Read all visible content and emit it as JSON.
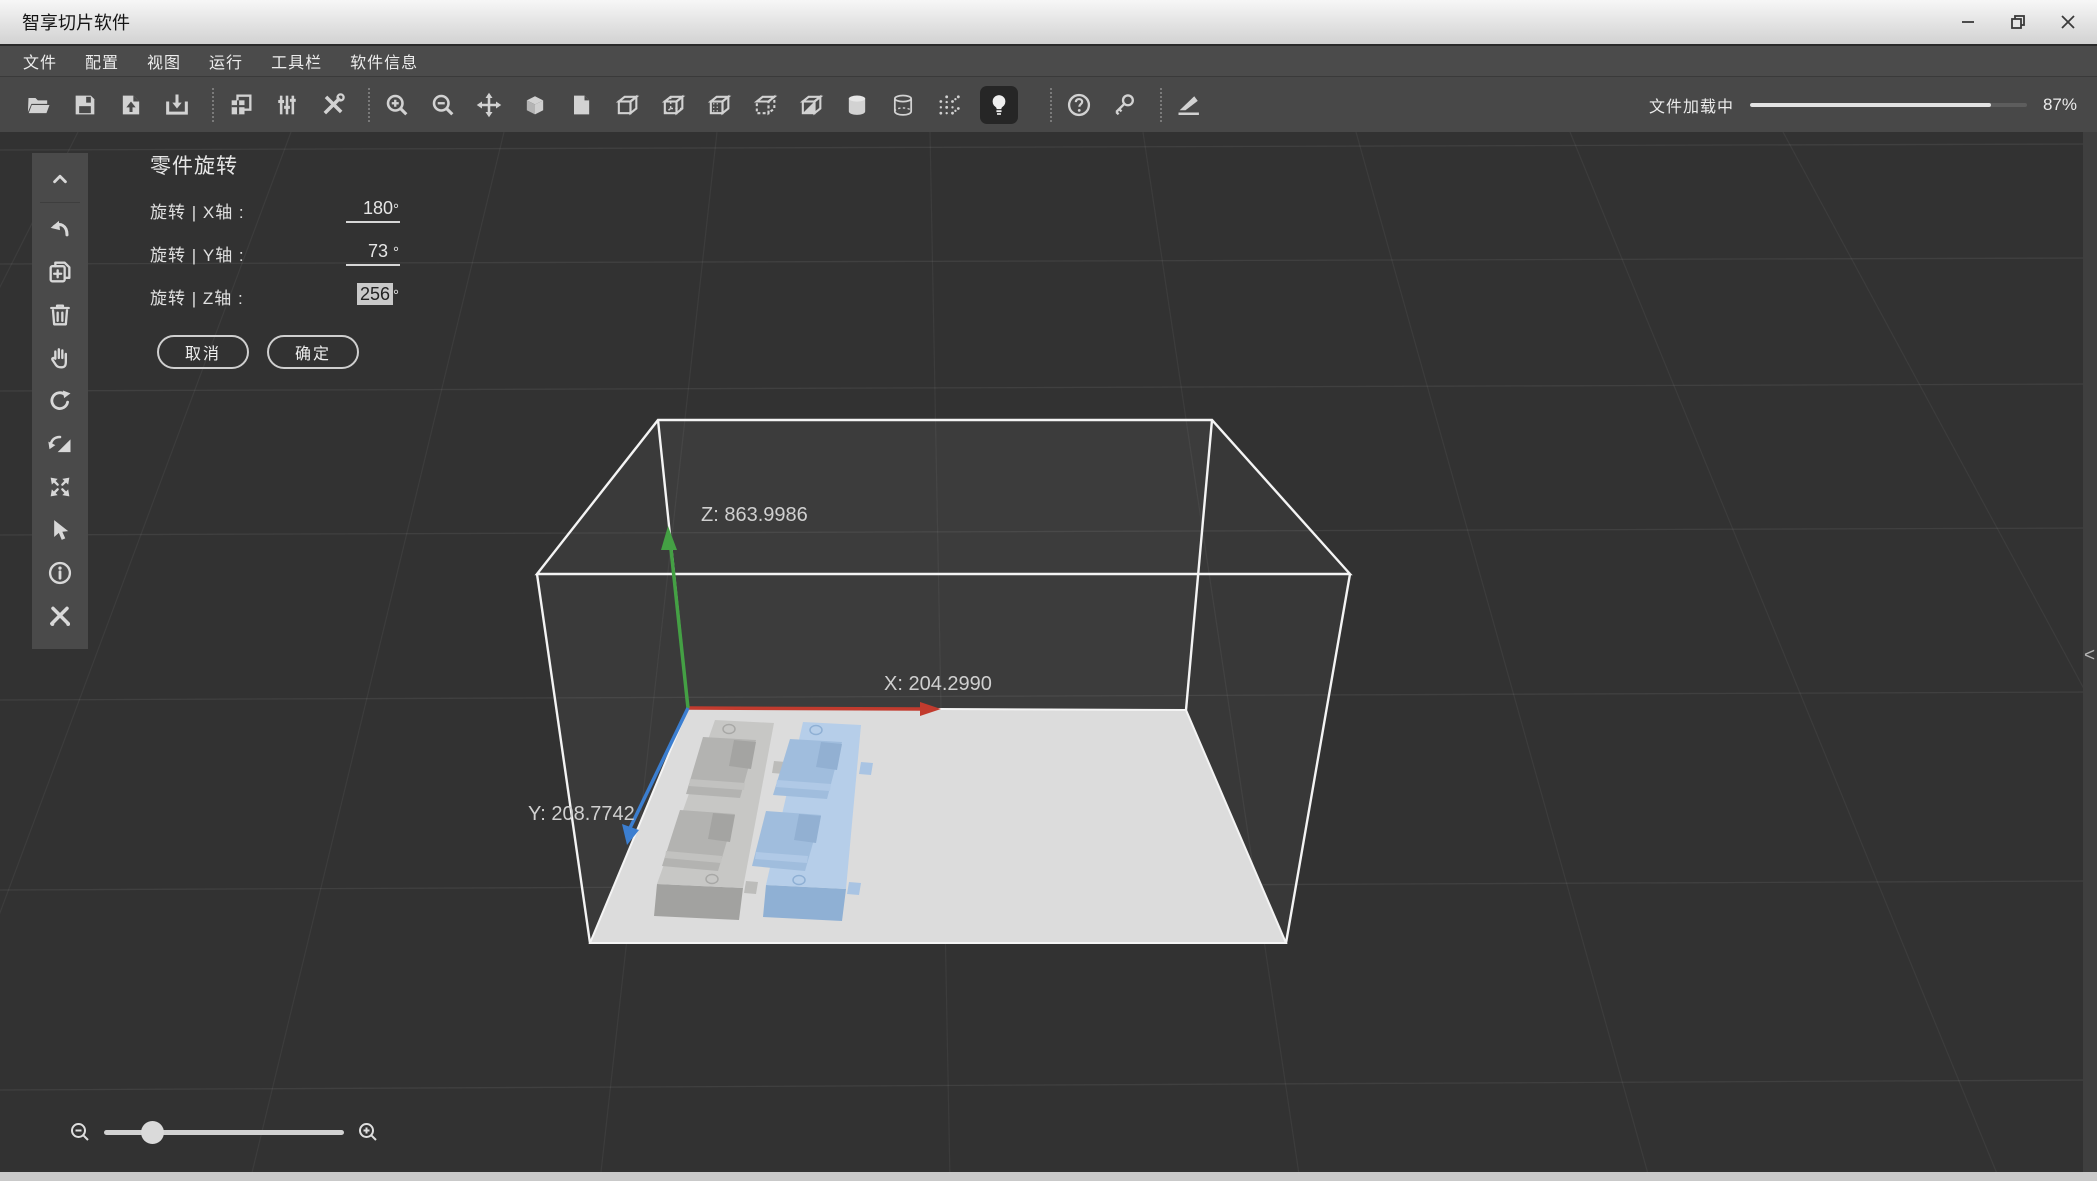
{
  "window": {
    "title": "智享切片软件",
    "controls": [
      "minimize",
      "restore",
      "close"
    ]
  },
  "menu": {
    "items": [
      "文件",
      "配置",
      "视图",
      "运行",
      "工具栏",
      "软件信息"
    ]
  },
  "toolbar": {
    "icons": [
      "open-file",
      "save-file",
      "import-model",
      "download-model",
      "duplicate-plate",
      "parameter-sliders",
      "tools-settings",
      "zoom-in",
      "zoom-out",
      "move-model",
      "view-solid",
      "view-surface",
      "view-wireframe",
      "view-hidden-edges",
      "view-dotted",
      "view-dashed-bottom",
      "view-half-section",
      "view-cylinder-solid",
      "view-cylinder-wireframe",
      "view-point-cloud",
      "light-toggle",
      "help",
      "license-key",
      "cut-tool"
    ],
    "active_icon": "light-toggle",
    "progress": {
      "label": "文件加载中",
      "percent": 87,
      "percent_label": "87%"
    }
  },
  "side_toolbar": {
    "icons": [
      "collapse-up",
      "undo",
      "duplicate",
      "delete",
      "pan-hand",
      "rotate",
      "mirror",
      "fit-view",
      "select-cursor",
      "info",
      "edit-tools"
    ]
  },
  "rotation_panel": {
    "title": "零件旋转",
    "rows": [
      {
        "label": "旋转 | X轴 :",
        "value": "180",
        "unit": "°",
        "selected": false
      },
      {
        "label": "旋转 | Y轴 :",
        "value": "73",
        "unit": "°",
        "selected": false
      },
      {
        "label": "旋转 | Z轴 :",
        "value": "256",
        "unit": "°",
        "selected": true
      }
    ],
    "cancel_label": "取消",
    "confirm_label": "确定"
  },
  "viewport": {
    "axis_labels": {
      "z": "Z:  863.9986",
      "x": "X: 204.2990",
      "y": "Y:  208.7742"
    },
    "axis_colors": {
      "x": "#c23b2e",
      "y": "#3b7ed0",
      "z": "#44a044"
    },
    "models": [
      {
        "name": "tray-model-gray",
        "color": "#c7c7c5"
      },
      {
        "name": "tray-model-blue",
        "color": "#b6cee9"
      }
    ],
    "collapse_chevron": "<"
  },
  "zoom_control": {
    "value_percent": 20
  }
}
